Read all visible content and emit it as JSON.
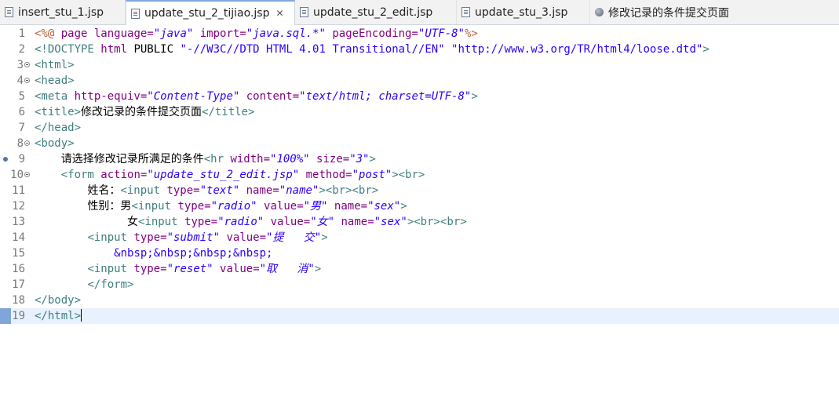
{
  "tabs": [
    {
      "label": "insert_stu_1.jsp",
      "active": false,
      "icon": "jsp-file-icon"
    },
    {
      "label": "update_stu_2_tijiao.jsp",
      "active": true,
      "icon": "jsp-file-icon",
      "close": "✕"
    },
    {
      "label": "update_stu_2_edit.jsp",
      "active": false,
      "icon": "jsp-file-icon"
    },
    {
      "label": "update_stu_3.jsp",
      "active": false,
      "icon": "jsp-file-icon"
    },
    {
      "label": "修改记录的条件提交页面",
      "active": false,
      "icon": "web-browser-icon"
    }
  ],
  "editor": {
    "current_line": 19,
    "lines": [
      {
        "n": "1",
        "tokens": [
          [
            "dr",
            "<%@ "
          ],
          [
            "at",
            "page "
          ],
          [
            "at",
            "language="
          ],
          [
            "vl",
            "\"java\" "
          ],
          [
            "at",
            "import="
          ],
          [
            "vl",
            "\"java.sql.*\" "
          ],
          [
            "at",
            "pageEncoding="
          ],
          [
            "vl",
            "\"UTF-8\""
          ],
          [
            "dr",
            "%>"
          ]
        ]
      },
      {
        "n": "2",
        "tokens": [
          [
            "tg",
            "<!"
          ],
          [
            "tg",
            "DOCTYPE "
          ],
          [
            "at",
            "html "
          ],
          [
            "tx",
            "PUBLIC "
          ],
          [
            "en",
            "\"-//W3C//DTD HTML 4.01 Transitional//EN\" "
          ],
          [
            "en",
            "\"http://www.w3.org/TR/html4/loose.dtd\""
          ],
          [
            "tg",
            ">"
          ]
        ]
      },
      {
        "n": "3",
        "fold": true,
        "tokens": [
          [
            "tg",
            "<html>"
          ]
        ]
      },
      {
        "n": "4",
        "fold": true,
        "tokens": [
          [
            "tg",
            "<head>"
          ]
        ]
      },
      {
        "n": "5",
        "tokens": [
          [
            "tg",
            "<meta "
          ],
          [
            "at",
            "http-equiv="
          ],
          [
            "vl",
            "\"Content-Type\" "
          ],
          [
            "at",
            "content="
          ],
          [
            "vl",
            "\"text/html; charset=UTF-8\""
          ],
          [
            "tg",
            ">"
          ]
        ]
      },
      {
        "n": "6",
        "tokens": [
          [
            "tg",
            "<title>"
          ],
          [
            "tx",
            "修改记录的条件提交页面"
          ],
          [
            "tg",
            "</title>"
          ]
        ]
      },
      {
        "n": "7",
        "tokens": [
          [
            "tg",
            "</head>"
          ]
        ]
      },
      {
        "n": "8",
        "fold": true,
        "tokens": [
          [
            "tg",
            "<body>"
          ]
        ]
      },
      {
        "n": "9",
        "mark": true,
        "tokens": [
          [
            "tx",
            "    请选择修改记录所满足的条件"
          ],
          [
            "tg",
            "<hr "
          ],
          [
            "at",
            "width="
          ],
          [
            "vl",
            "\"100%\" "
          ],
          [
            "at",
            "size="
          ],
          [
            "vl",
            "\"3\""
          ],
          [
            "tg",
            ">"
          ]
        ]
      },
      {
        "n": "10",
        "fold": true,
        "tokens": [
          [
            "tx",
            "    "
          ],
          [
            "tg",
            "<form "
          ],
          [
            "at",
            "action="
          ],
          [
            "vl",
            "\"update_stu_2_edit.jsp\" "
          ],
          [
            "at",
            "method="
          ],
          [
            "vl",
            "\"post\""
          ],
          [
            "tg",
            "><br>"
          ]
        ]
      },
      {
        "n": "11",
        "tokens": [
          [
            "tx",
            "        姓名："
          ],
          [
            "tg",
            "<input "
          ],
          [
            "at",
            "type="
          ],
          [
            "vl",
            "\"text\" "
          ],
          [
            "at",
            "name="
          ],
          [
            "vl",
            "\"name\""
          ],
          [
            "tg",
            "><br><br>"
          ]
        ]
      },
      {
        "n": "12",
        "tokens": [
          [
            "tx",
            "        性别：男"
          ],
          [
            "tg",
            "<input "
          ],
          [
            "at",
            "type="
          ],
          [
            "vl",
            "\"radio\" "
          ],
          [
            "at",
            "value="
          ],
          [
            "vl",
            "\"男\" "
          ],
          [
            "at",
            "name="
          ],
          [
            "vl",
            "\"sex\""
          ],
          [
            "tg",
            ">"
          ]
        ]
      },
      {
        "n": "13",
        "tokens": [
          [
            "tx",
            "              女"
          ],
          [
            "tg",
            "<input "
          ],
          [
            "at",
            "type="
          ],
          [
            "vl",
            "\"radio\" "
          ],
          [
            "at",
            "value="
          ],
          [
            "vl",
            "\"女\" "
          ],
          [
            "at",
            "name="
          ],
          [
            "vl",
            "\"sex\""
          ],
          [
            "tg",
            "><br><br>"
          ]
        ]
      },
      {
        "n": "14",
        "tokens": [
          [
            "tx",
            "        "
          ],
          [
            "tg",
            "<input "
          ],
          [
            "at",
            "type="
          ],
          [
            "vl",
            "\"submit\" "
          ],
          [
            "at",
            "value="
          ],
          [
            "vl",
            "\"提   交\""
          ],
          [
            "tg",
            ">"
          ]
        ]
      },
      {
        "n": "15",
        "tokens": [
          [
            "tx",
            "            "
          ],
          [
            "en",
            "&nbsp;&nbsp;&nbsp;&nbsp;"
          ]
        ]
      },
      {
        "n": "16",
        "tokens": [
          [
            "tx",
            "        "
          ],
          [
            "tg",
            "<input "
          ],
          [
            "at",
            "type="
          ],
          [
            "vl",
            "\"reset\" "
          ],
          [
            "at",
            "value="
          ],
          [
            "vl",
            "\"取   消\""
          ],
          [
            "tg",
            ">"
          ]
        ]
      },
      {
        "n": "17",
        "tokens": [
          [
            "tx",
            "        "
          ],
          [
            "tg",
            "</form>"
          ]
        ]
      },
      {
        "n": "18",
        "tokens": [
          [
            "tg",
            "</body>"
          ]
        ]
      },
      {
        "n": "19",
        "tokens": [
          [
            "tg",
            "</html>"
          ]
        ],
        "caret": true
      }
    ]
  }
}
